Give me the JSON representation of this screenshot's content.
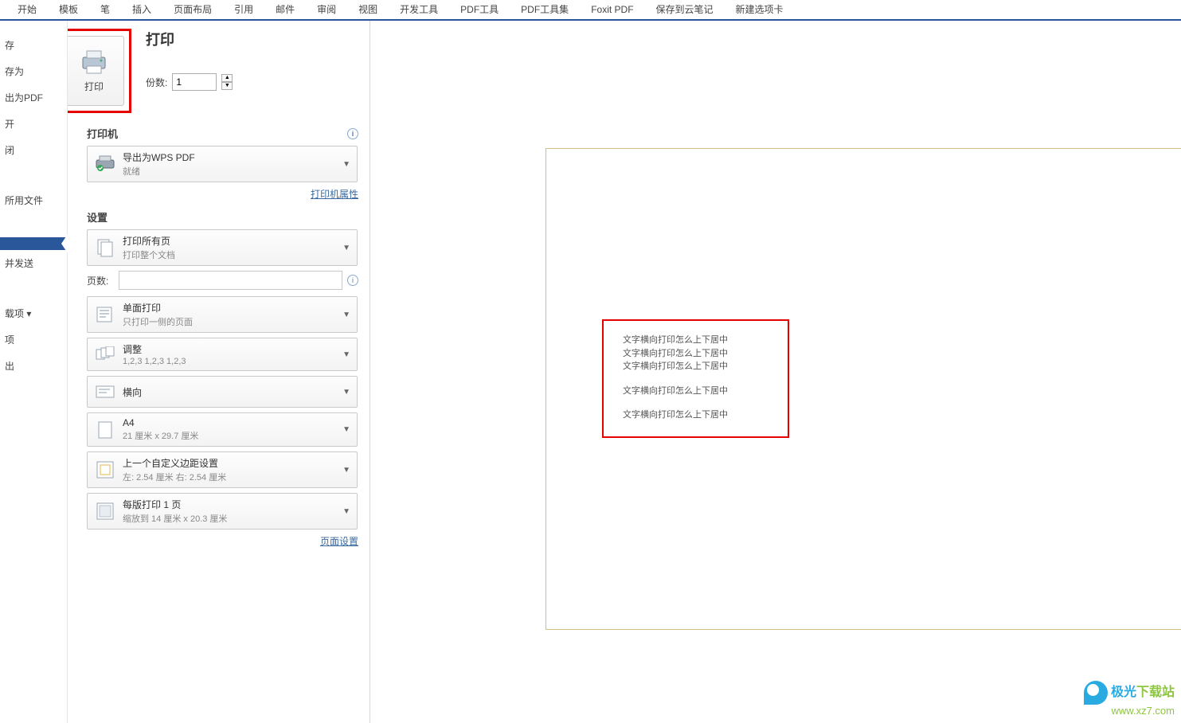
{
  "ribbon": [
    "开始",
    "模板",
    "笔",
    "插入",
    "页面布局",
    "引用",
    "邮件",
    "审阅",
    "视图",
    "开发工具",
    "PDF工具",
    "PDF工具集",
    "Foxit PDF",
    "保存到云笔记",
    "新建选项卡"
  ],
  "leftnav": {
    "items": [
      "存",
      "存为",
      "出为PDF",
      "开",
      "闭"
    ],
    "recent": "所用文件",
    "selected": "",
    "send": "并发送",
    "bottom": [
      "载项 ▾",
      "项",
      "出"
    ]
  },
  "print": {
    "title": "打印",
    "button": "打印",
    "copies_label": "份数:",
    "copies_value": "1"
  },
  "printer": {
    "title": "打印机",
    "device": "导出为WPS PDF",
    "status": "就绪",
    "properties": "打印机属性"
  },
  "settings": {
    "title": "设置",
    "range": {
      "l1": "打印所有页",
      "l2": "打印整个文档"
    },
    "pages_label": "页数:",
    "duplex": {
      "l1": "单面打印",
      "l2": "只打印一侧的页面"
    },
    "collate": {
      "l1": "调整",
      "l2": "1,2,3    1,2,3    1,2,3"
    },
    "orientation": {
      "l1": "横向"
    },
    "paper": {
      "l1": "A4",
      "l2": "21 厘米 x 29.7 厘米"
    },
    "margins": {
      "l1": "上一个自定义边距设置",
      "l2": "左: 2.54 厘米    右: 2.54 厘米"
    },
    "perpage": {
      "l1": "每版打印 1 页",
      "l2": "缩放到 14 厘米 x 20.3 厘米"
    },
    "pagesetup": "页面设置"
  },
  "preview": {
    "lines": [
      "文字横向打印怎么上下居中",
      "文字横向打印怎么上下居中",
      "文字横向打印怎么上下居中",
      "",
      "文字横向打印怎么上下居中",
      "",
      "文字横向打印怎么上下居中"
    ]
  },
  "watermark": {
    "l1a": "极光",
    "l1b": "下载站",
    "l2": "www.xz7.com"
  }
}
